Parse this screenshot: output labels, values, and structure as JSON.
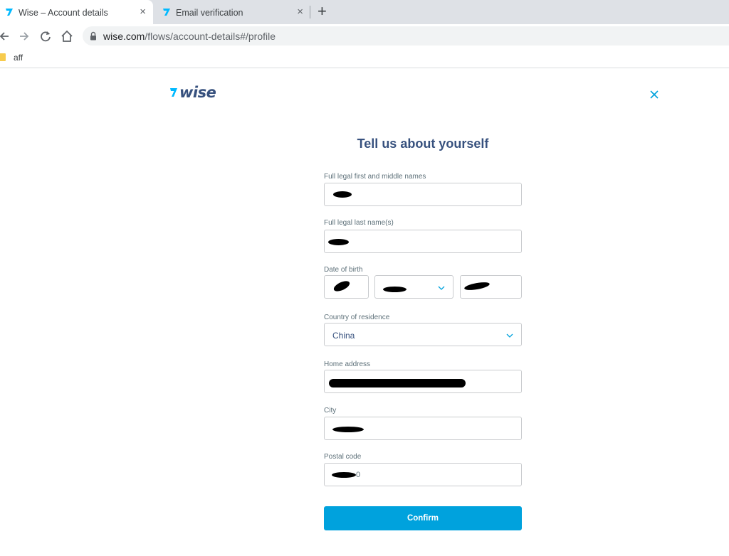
{
  "browser": {
    "tabs": [
      {
        "label": "Wise – Account details",
        "close": "×"
      },
      {
        "label": "Email verification",
        "close": "×"
      }
    ],
    "new_tab": "+",
    "url_host": "wise.com",
    "url_path": "/flows/account-details#/profile",
    "bookmark": "aff"
  },
  "page": {
    "brand": "wise",
    "heading": "Tell us about yourself",
    "fields": {
      "first_names_label": "Full legal first and middle names",
      "last_name_label": "Full legal last name(s)",
      "dob_label": "Date of birth",
      "country_label": "Country of residence",
      "country_value": "China",
      "address_label": "Home address",
      "city_label": "City",
      "postal_label": "Postal code",
      "postal_suffix": "0"
    },
    "confirm_label": "Confirm"
  },
  "colors": {
    "brand_navy": "#37517e",
    "accent_blue": "#00a2dd",
    "flag_cyan": "#00b9ff"
  },
  "icons": [
    "wise-flag-icon",
    "back-arrow-icon",
    "forward-arrow-icon",
    "reload-icon",
    "home-icon",
    "lock-icon",
    "folder-icon",
    "close-icon",
    "chevron-down-icon"
  ]
}
